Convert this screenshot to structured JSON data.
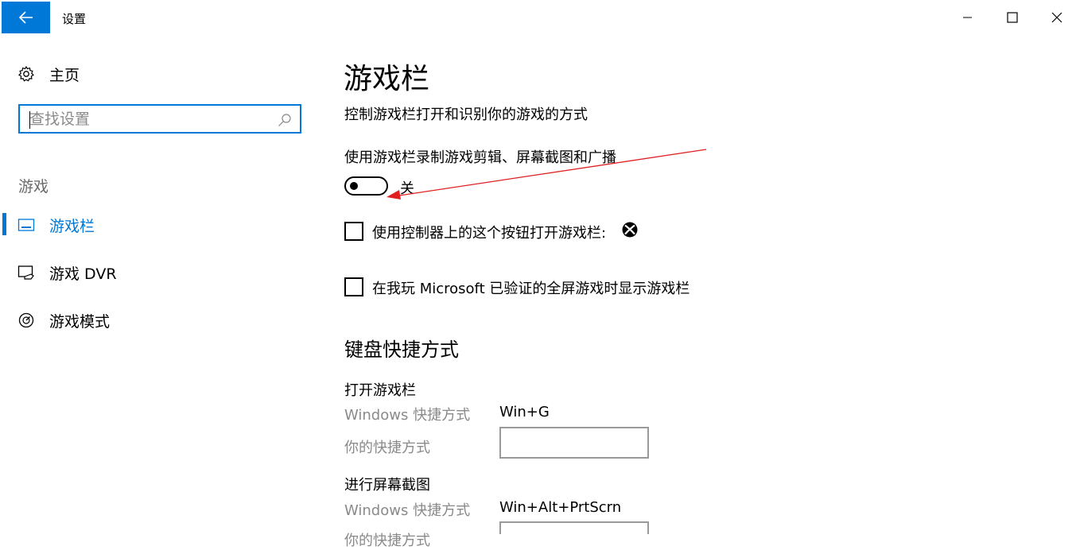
{
  "window": {
    "title": "设置",
    "back_icon": "arrow-left-icon",
    "accent_color": "#0078d7"
  },
  "sidebar": {
    "home_label": "主页",
    "search_placeholder": "查找设置",
    "category_label": "游戏",
    "items": [
      {
        "label": "游戏栏",
        "icon": "game-bar-icon",
        "selected": true
      },
      {
        "label": "游戏 DVR",
        "icon": "game-dvr-icon",
        "selected": false
      },
      {
        "label": "游戏模式",
        "icon": "game-mode-icon",
        "selected": false
      }
    ]
  },
  "main": {
    "title": "游戏栏",
    "subtitle": "控制游戏栏打开和识别你的游戏的方式",
    "toggle": {
      "label": "使用游戏栏录制游戏剪辑、屏幕截图和广播",
      "state_label": "关",
      "on": false
    },
    "checkbox_controller": {
      "label": "使用控制器上的这个按钮打开游戏栏:",
      "checked": false,
      "icon": "xbox-icon"
    },
    "checkbox_fullscreen": {
      "label": "在我玩 Microsoft 已验证的全屏游戏时显示游戏栏",
      "checked": false
    },
    "keyboard": {
      "section_title": "键盘快捷方式",
      "groups": [
        {
          "title": "打开游戏栏",
          "windows_label": "Windows 快捷方式",
          "windows_value": "Win+G",
          "yours_label": "你的快捷方式",
          "yours_value": ""
        },
        {
          "title": "进行屏幕截图",
          "windows_label": "Windows 快捷方式",
          "windows_value": "Win+Alt+PrtScrn",
          "yours_label": "你的快捷方式",
          "yours_value": ""
        }
      ]
    }
  }
}
